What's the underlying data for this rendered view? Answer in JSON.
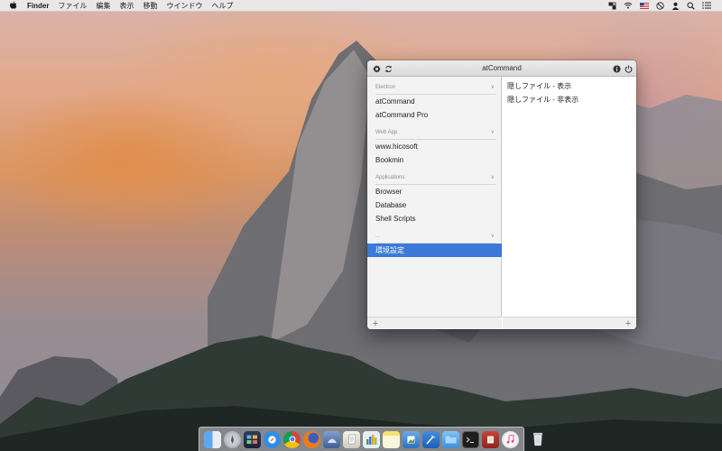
{
  "menubar": {
    "app_name": "Finder",
    "items": [
      "ファイル",
      "編集",
      "表示",
      "移動",
      "ウインドウ",
      "ヘルプ"
    ]
  },
  "window": {
    "title": "atCommand",
    "sidebar": {
      "groups": [
        {
          "header": "Electron",
          "items": [
            "atCommand",
            "atCommand Pro"
          ]
        },
        {
          "header": "Web App",
          "items": [
            "www.hicosoft",
            "Bookmin"
          ]
        },
        {
          "header": "Applications",
          "items": [
            "Browser",
            "Database",
            "Shell Scripts"
          ]
        },
        {
          "header": "...",
          "items": [
            "環境設定"
          ]
        }
      ],
      "selected_item": "環境設定"
    },
    "commands": [
      "隠しファイル - 表示",
      "隠しファイル - 非表示"
    ]
  },
  "dock": {
    "icons": [
      "finder-icon",
      "launchpad-icon",
      "mission-control-icon",
      "safari-icon",
      "chrome-icon",
      "firefox-icon",
      "migration-icon",
      "script-editor-icon",
      "numbers-icon",
      "notes-icon",
      "preview-icon",
      "xcode-icon",
      "folder-icon",
      "terminal-icon",
      "book-icon",
      "itunes-icon",
      "trash-icon"
    ]
  },
  "colors": {
    "selection": "#3b7ad8",
    "sidebar_bg": "#f3f3f3"
  }
}
